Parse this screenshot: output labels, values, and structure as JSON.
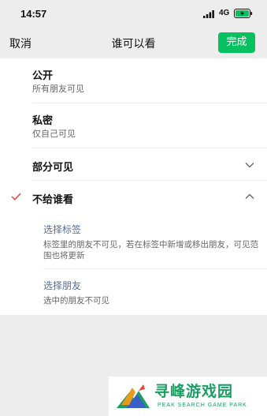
{
  "status_bar": {
    "time": "14:57",
    "network": "4G"
  },
  "nav": {
    "cancel_label": "取消",
    "title": "谁可以看",
    "done_label": "完成"
  },
  "options": [
    {
      "title": "公开",
      "desc": "所有朋友可见",
      "selected": false
    },
    {
      "title": "私密",
      "desc": "仅自己可见",
      "selected": false
    },
    {
      "title": "部分可见",
      "desc": "",
      "selected": false,
      "expanded": false
    },
    {
      "title": "不给谁看",
      "desc": "",
      "selected": true,
      "expanded": true
    }
  ],
  "sub_options": [
    {
      "title": "选择标签",
      "desc": "标签里的朋友不可见，若在标签中新增或移出朋友，可见范围也将更新"
    },
    {
      "title": "选择朋友",
      "desc": "选中的朋友不可见"
    }
  ],
  "watermark": {
    "name": "寻峰游戏园",
    "sub": "PEAK SEARCH GAME PARK"
  },
  "colors": {
    "accent_green": "#07c160",
    "link_blue": "#576b95",
    "check_red": "#e64340",
    "background": "#ededed"
  }
}
